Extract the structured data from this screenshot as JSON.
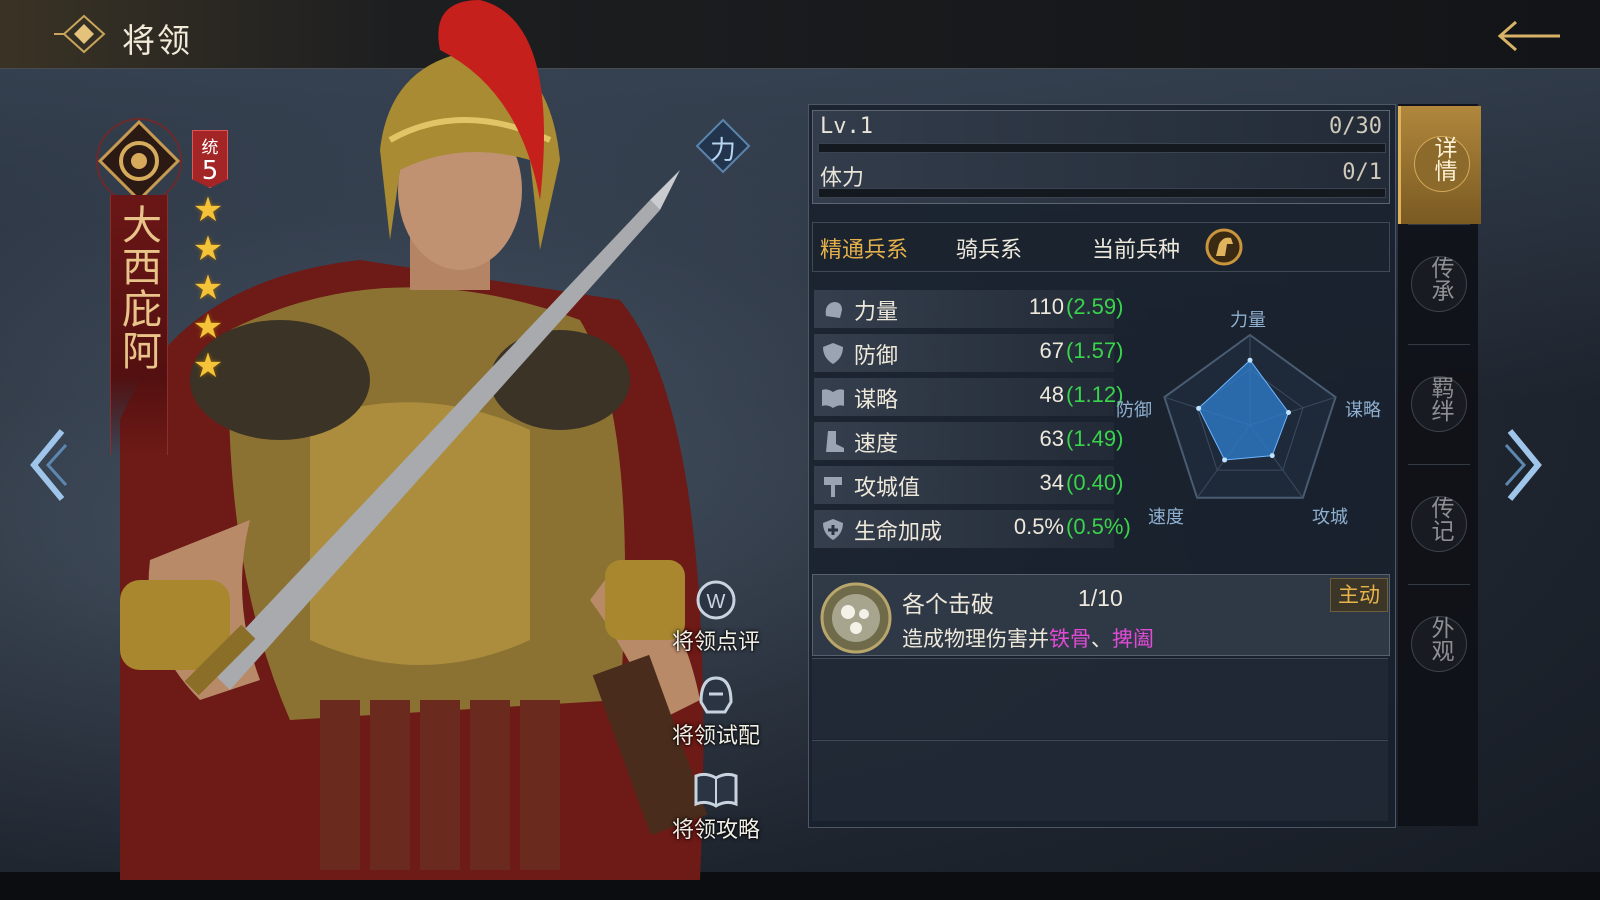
{
  "header": {
    "title": "将领"
  },
  "hero": {
    "name": "大西庇阿",
    "command_label": "统",
    "command_value": "5",
    "stars": 5,
    "attribute_badge": "力"
  },
  "actions": [
    {
      "label": "将领点评",
      "icon": "comment-icon"
    },
    {
      "label": "将领试配",
      "icon": "helmet-icon"
    },
    {
      "label": "将领攻略",
      "icon": "book-icon"
    }
  ],
  "level": {
    "label": "Lv.1",
    "value": "0/30",
    "progress": 0
  },
  "stamina": {
    "label": "体力",
    "value": "0/1",
    "progress": 0
  },
  "troop": {
    "mastery_label": "精通兵系",
    "mastery_value": "骑兵系",
    "current_label": "当前兵种",
    "current_icon": "horse-icon"
  },
  "stats": [
    {
      "name": "力量",
      "value": "110",
      "growth": "(2.59)",
      "icon": "fist-icon"
    },
    {
      "name": "防御",
      "value": "67",
      "growth": "(1.57)",
      "icon": "shield-icon"
    },
    {
      "name": "谋略",
      "value": "48",
      "growth": "(1.12)",
      "icon": "book-icon"
    },
    {
      "name": "速度",
      "value": "63",
      "growth": "(1.49)",
      "icon": "boot-icon"
    },
    {
      "name": "攻城值",
      "value": "34",
      "growth": "(0.40)",
      "icon": "hammer-icon"
    },
    {
      "name": "生命加成",
      "value": "0.5%",
      "growth": "(0.5%)",
      "icon": "heart-shield-icon"
    }
  ],
  "radar": {
    "labels": {
      "top": "力量",
      "right": "谋略",
      "bottom_right": "攻城",
      "bottom_left": "速度",
      "left": "防御"
    },
    "values": {
      "strength": 0.72,
      "strategy": 0.45,
      "siege": 0.42,
      "speed": 0.48,
      "defense": 0.6
    }
  },
  "skill": {
    "name": "各个击破",
    "level": "1/10",
    "type": "主动",
    "desc_prefix": "造成物理伤害并",
    "desc_hl1": "铁骨",
    "desc_sep": "、",
    "desc_hl2": "捭阖"
  },
  "tabs": [
    {
      "label": "详情",
      "active": true
    },
    {
      "label": "传承",
      "active": false
    },
    {
      "label": "羁绊",
      "active": false
    },
    {
      "label": "传记",
      "active": false
    },
    {
      "label": "外观",
      "active": false
    }
  ],
  "colors": {
    "growth": "#39d44a",
    "gold": "#e3b04b",
    "highlight": "#e04ad6",
    "banner": "#6b1616"
  }
}
